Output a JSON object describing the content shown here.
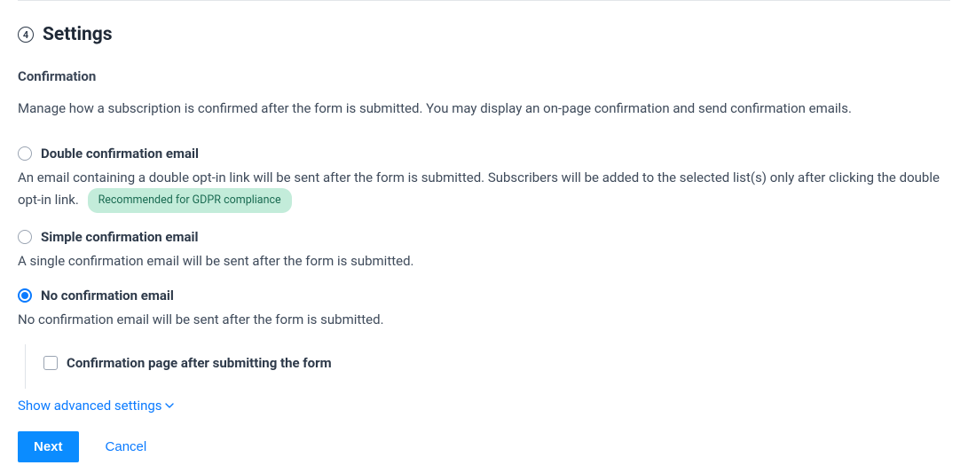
{
  "header": {
    "step_number": "4",
    "title": "Settings"
  },
  "confirmation": {
    "subtitle": "Confirmation",
    "description": "Manage how a subscription is confirmed after the form is submitted. You may display an on-page confirmation and send confirmation emails.",
    "options": {
      "double": {
        "label": "Double confirmation email",
        "desc": "An email containing a double opt-in link will be sent after the form is submitted. Subscribers will be added to the selected list(s) only after clicking the double opt-in link.",
        "badge": "Recommended for GDPR compliance"
      },
      "simple": {
        "label": "Simple confirmation email",
        "desc": "A single confirmation email will be sent after the form is submitted."
      },
      "none": {
        "label": "No confirmation email",
        "desc": "No confirmation email will be sent after the form is submitted.",
        "checkbox_label": "Confirmation page after submitting the form"
      }
    },
    "selected": "none"
  },
  "advanced_link": "Show advanced settings",
  "buttons": {
    "next": "Next",
    "cancel": "Cancel"
  }
}
